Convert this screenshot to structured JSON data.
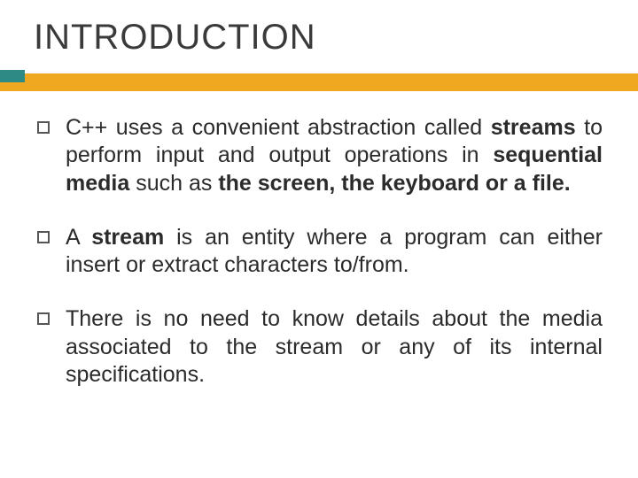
{
  "title": "INTRODUCTION",
  "colors": {
    "accent_bar": "#f0a821",
    "accent_tab": "#2e8a84"
  },
  "bullets": [
    {
      "html": "C++ uses a convenient abstraction called <b>streams</b> to perform input and output operations in <b>sequential media</b> such as <b>the screen, the keyboard or a file.</b>"
    },
    {
      "html": "A <b>stream</b> is an entity where a program can either insert or extract characters to/from."
    },
    {
      "html": "There is no need to know details about the media associated to the stream or any of its internal specifications."
    }
  ]
}
